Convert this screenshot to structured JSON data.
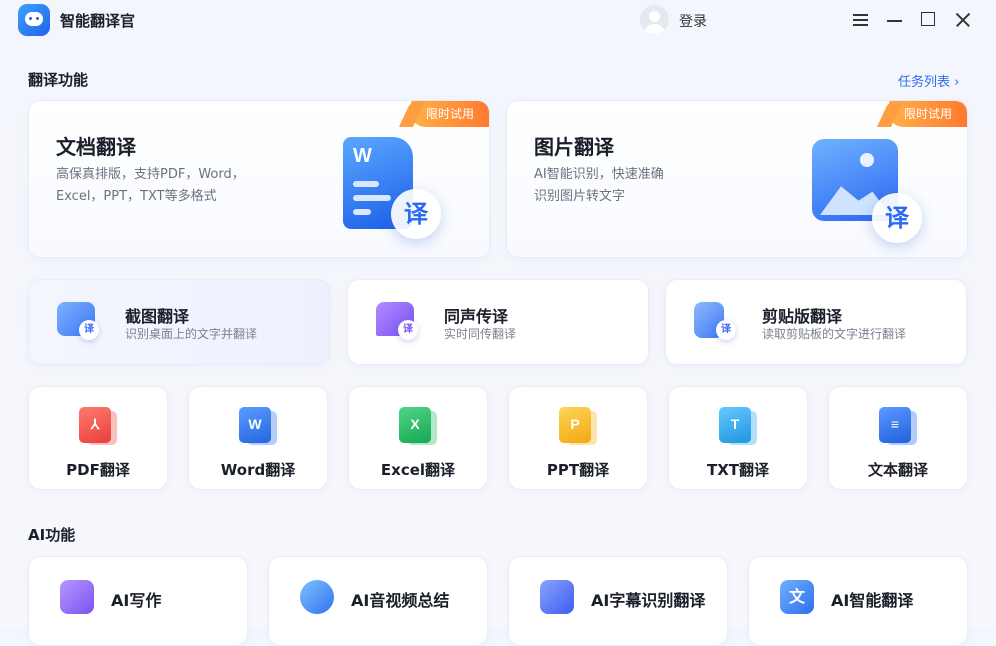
{
  "app": {
    "title": "智能翻译官",
    "login_label": "登录"
  },
  "translate_section": {
    "title": "翻译功能",
    "tasks_link": "任务列表 ›"
  },
  "big_cards": [
    {
      "title": "文档翻译",
      "desc_line1": "高保真排版，支持PDF，Word，",
      "desc_line2": "Excel，PPT，TXT等多格式",
      "ribbon": "限时试用",
      "illus_letter": "W",
      "badge": "译"
    },
    {
      "title": "图片翻译",
      "desc_line1": "AI智能识别，快速准确",
      "desc_line2": "识别图片转文字",
      "ribbon": "限时试用",
      "badge": "译"
    }
  ],
  "mid_cards": [
    {
      "title": "截图翻译",
      "subtitle": "识别桌面上的文字并翻译",
      "badge": "译",
      "color": "#4a86f5"
    },
    {
      "title": "同声传译",
      "subtitle": "实时同传翻译",
      "badge": "译",
      "color": "#8b62f3"
    },
    {
      "title": "剪贴版翻译",
      "subtitle": "读取剪贴板的文字进行翻译",
      "badge": "译",
      "color": "#4a86f5"
    }
  ],
  "format_cards": [
    {
      "label": "PDF翻译",
      "glyph": "⅄",
      "color": "#ef4b45"
    },
    {
      "label": "Word翻译",
      "glyph": "W",
      "color": "#2e74e8"
    },
    {
      "label": "Excel翻译",
      "glyph": "X",
      "color": "#1fb860"
    },
    {
      "label": "PPT翻译",
      "glyph": "P",
      "color": "#f5b31c"
    },
    {
      "label": "TXT翻译",
      "glyph": "T",
      "color": "#25a6e8"
    },
    {
      "label": "文本翻译",
      "glyph": "≡",
      "color": "#2a6bea"
    }
  ],
  "ai_section": {
    "title": "AI功能"
  },
  "ai_cards": [
    {
      "label": "AI写作",
      "color": "#8a63f0"
    },
    {
      "label": "AI音视频总结",
      "color": "#3b82f0"
    },
    {
      "label": "AI字幕识别翻译",
      "color": "#4a6cf0"
    },
    {
      "label": "AI智能翻译",
      "color": "#3a78f0",
      "glyph": "文"
    }
  ]
}
